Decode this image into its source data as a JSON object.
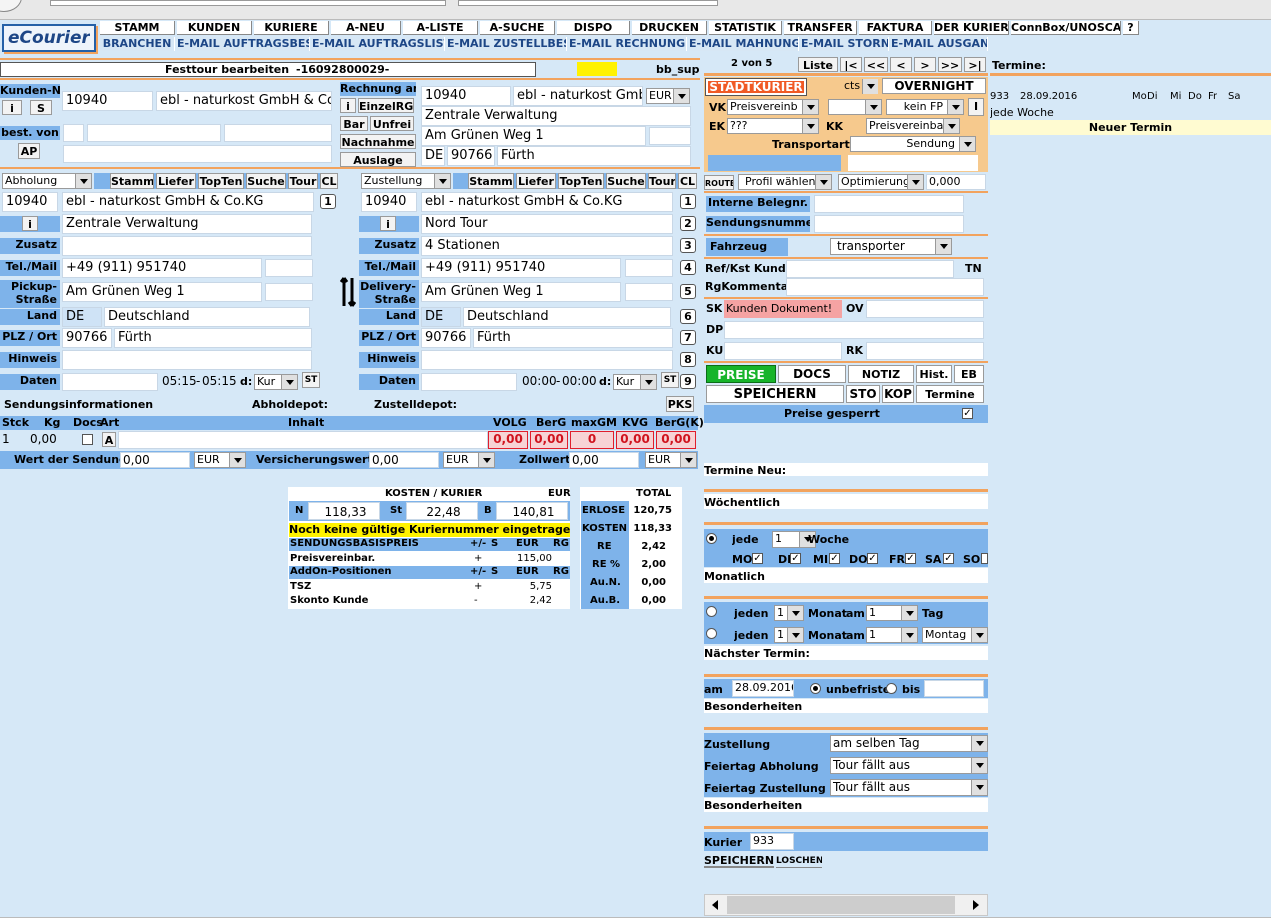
{
  "top_fields": [
    "",
    ""
  ],
  "logo": "eCourier",
  "nav1": [
    "STAMM",
    "KUNDEN",
    "KURIERE",
    "A-NEU",
    "A-LISTE",
    "A-SUCHE",
    "DISPO",
    "DRUCKEN",
    "STATISTIK",
    "TRANSFER",
    "FAKTURA",
    "DER KURIER",
    "ConnBox/UNOSCAN",
    "?"
  ],
  "nav2": [
    "BRANCHEN",
    "E-MAIL AUFTRAGSBEST.",
    "E-MAIL AUFTRAGSLISTE",
    "E-MAIL ZUSTELLBEST.",
    "E-MAIL RECHNUNGEN",
    "E-MAIL MAHNUNGEN",
    "E-MAIL STORNO",
    "E-MAIL AUSGANG"
  ],
  "header": {
    "title": "Festtour bearbeiten",
    "number": "-16092800029-",
    "user": "bb_sup"
  },
  "customer": {
    "label": "Kunden-Nr.",
    "i": "i",
    "s": "S",
    "number": "10940",
    "name": "ebl - naturkost GmbH & Co.",
    "ordered_by": "best. von",
    "ap": "AP"
  },
  "billing": {
    "label": "Rechnung an",
    "i": "i",
    "single": "EinzelRG",
    "bar": "Bar",
    "unfrei": "Unfrei",
    "cod": "Nachnahme",
    "payout": "Auslage",
    "number": "10940",
    "name": "ebl - naturkost Gmb",
    "currency": "EUR",
    "dept": "Zentrale Verwaltung",
    "street": "Am Grünen Weg 1",
    "country": "DE",
    "zip": "90766",
    "city": "Fürth"
  },
  "pickup": {
    "mode": "Abholung",
    "tabs": [
      "Stamm",
      "Liefer",
      "TopTen",
      "Suche",
      "Tour",
      "CL"
    ],
    "number": "10940",
    "name": "ebl - naturkost GmbH & Co.KG",
    "i": "i",
    "dept": "Zentrale Verwaltung",
    "zusatz_label": "Zusatz",
    "zusatz": "",
    "tel_label": "Tel./Mail",
    "tel": "+49 (911) 951740",
    "street_label": "Pickup-\nStraße",
    "street": "Am Grünen Weg 1",
    "land_label": "Land",
    "country_code": "DE",
    "country": "Deutschland",
    "plz_label": "PLZ / Ort",
    "zip": "90766",
    "city": "Fürth",
    "note_label": "Hinweis",
    "date_label": "Daten",
    "time_from": "05:15",
    "time_to": "05:15",
    "d_label": "d:",
    "d_value": "Kur",
    "st": "ST"
  },
  "delivery": {
    "mode": "Zustellung",
    "tabs": [
      "Stamm",
      "Liefer",
      "TopTen",
      "Suche",
      "Tour",
      "CL"
    ],
    "number": "10940",
    "name": "ebl - naturkost GmbH & Co.KG",
    "i": "i",
    "dept": "Nord Tour",
    "zusatz_label": "Zusatz",
    "zusatz": "4 Stationen",
    "tel_label": "Tel./Mail",
    "tel": "+49 (911) 951740",
    "street_label": "Delivery-\nStraße",
    "street": "Am Grünen Weg 1",
    "land_label": "Land",
    "country_code": "DE",
    "country": "Deutschland",
    "plz_label": "PLZ / Ort",
    "zip": "90766",
    "city": "Fürth",
    "note_label": "Hinweis",
    "date_label": "Daten",
    "time_from": "00:00",
    "time_to": "00:00",
    "d_label": "d:",
    "d_value": "Kur",
    "st": "ST"
  },
  "row_numbers": [
    "1",
    "2",
    "3",
    "4",
    "5",
    "6",
    "7",
    "8",
    "9"
  ],
  "shipment": {
    "info": "Sendungsinformationen",
    "pickup_depot": "Abholdepot:",
    "delivery_depot": "Zustelldepot:",
    "pks": "PKS",
    "headers": [
      "Stck",
      "Kg",
      "Docs",
      "Art",
      "Inhalt",
      "VOLG",
      "BerG",
      "maxGM",
      "KVG",
      "BerG(K)"
    ],
    "stck": "1",
    "kg": "0,00",
    "art": "A",
    "inhalt": "",
    "volg": "0,00",
    "berg": "0,00",
    "maxgm": "0",
    "kvg": "0,00",
    "bergk": "0,00",
    "value_label": "Wert der Sendung",
    "value": "0,00",
    "value_cur": "EUR",
    "insured_label": "Versicherungswert",
    "insured": "0,00",
    "insured_cur": "EUR",
    "customs_label": "Zollwert",
    "customs": "0,00",
    "customs_cur": "EUR"
  },
  "costs": {
    "title": "KOSTEN / KURIER",
    "cur": "EUR",
    "n_label": "N",
    "n": "118,33",
    "st_label": "St",
    "st": "22,48",
    "b_label": "B",
    "b": "140,81",
    "warning": "Noch keine gültige Kuriernummer eingetragen!",
    "base_title": "SENDUNGSBASISPREIS",
    "cols": [
      "+/-",
      "S",
      "EUR",
      "RG"
    ],
    "base_rows": [
      {
        "name": "Preisvereinbar.",
        "sign": "+",
        "eur": "115,00"
      }
    ],
    "addon_title": "AddOn-Positionen",
    "addon_rows": [
      {
        "name": "TSZ",
        "sign": "+",
        "eur": "5,75"
      },
      {
        "name": "Skonto Kunde",
        "sign": "-",
        "eur": "2,42"
      }
    ]
  },
  "totals": {
    "title": "TOTAL",
    "rows": [
      {
        "label": "ERLÖSE",
        "value": "120,75"
      },
      {
        "label": "KOSTEN",
        "value": "118,33"
      },
      {
        "label": "RE",
        "value": "2,42"
      },
      {
        "label": "RE %",
        "value": "2,00"
      },
      {
        "label": "Au.N.",
        "value": "0,00"
      },
      {
        "label": "Au.B.",
        "value": "0,00"
      }
    ]
  },
  "pager": {
    "text": "2 von 5",
    "list": "Liste",
    "buttons": [
      "|<",
      "<<",
      "<",
      ">",
      ">>",
      ">|"
    ]
  },
  "service": {
    "city": "STADTKURIER",
    "cts": "cts",
    "overnight": "OVERNIGHT",
    "vk_label": "VK",
    "vk": "Preisvereinb",
    "vk2": "",
    "fp": "kein FP",
    "i": "I",
    "ek_label": "EK",
    "ek": "???",
    "kk_label": "KK",
    "kk": "Preisvereinba",
    "transport_label": "Transportart",
    "transport": "Sendung",
    "route": "ROUTE",
    "profile": "Profil wählen",
    "optimize": "Optimierung?",
    "opt_value": "0,000"
  },
  "refs": {
    "internal": "Interne Belegnr.",
    "shipment_no": "Sendungsnummer",
    "vehicle_label": "Fahrzeug",
    "vehicle": "transporter",
    "ref_label": "Ref/Kst Kunde",
    "tn": "TN",
    "rg_label": "RgKommentar"
  },
  "notes": {
    "sk": "SK",
    "sk_value": "Kunden Dokument!",
    "ov": "OV",
    "dp": "DP",
    "ku": "KU",
    "rk": "RK"
  },
  "actions": {
    "prices": "PREISE",
    "docs": "DOCS",
    "notiz": "NOTIZ",
    "hist": "Hist.",
    "eb": "EB",
    "save": "SPEICHERN",
    "sto": "STO",
    "kop": "KOP",
    "termine": "Termine",
    "locked": "Preise gesperrt"
  },
  "schedule": {
    "termine_label": "Termine:",
    "row": {
      "num": "933",
      "date": "28.09.2016",
      "days": [
        "Mo",
        "Di",
        "Mi",
        "Do",
        "Fr",
        "Sa"
      ]
    },
    "every_week": "jede Woche",
    "new_term": "Neuer Termin",
    "new_label": "Termine Neu:",
    "weekly": "Wöchentlich",
    "jede": "jede",
    "weeks": "1",
    "woche": "Woche",
    "days": [
      "MO",
      "DI",
      "MI",
      "DO",
      "FR",
      "SA",
      "SO"
    ],
    "monthly": "Monatlich",
    "jeden": "jeden",
    "monat": "Monat",
    "am": "am",
    "tag": "Tag",
    "n1": "1",
    "n2": "1",
    "weekday": "Montag",
    "next": "Nächster Termin:",
    "am_label": "am",
    "start": "28.09.2016",
    "unlimited": "unbefristet",
    "bis": "bis",
    "special": "Besonderheiten",
    "delivery_label": "Zustellung",
    "delivery": "am selben Tag",
    "holiday_pickup_label": "Feiertag Abholung",
    "holiday_pickup": "Tour fällt aus",
    "holiday_delivery_label": "Feiertag Zustellung",
    "holiday_delivery": "Tour fällt aus",
    "special2": "Besonderheiten",
    "courier_label": "Kurier",
    "courier": "933",
    "save": "SPEICHERN",
    "delete": "LÖSCHEN"
  }
}
